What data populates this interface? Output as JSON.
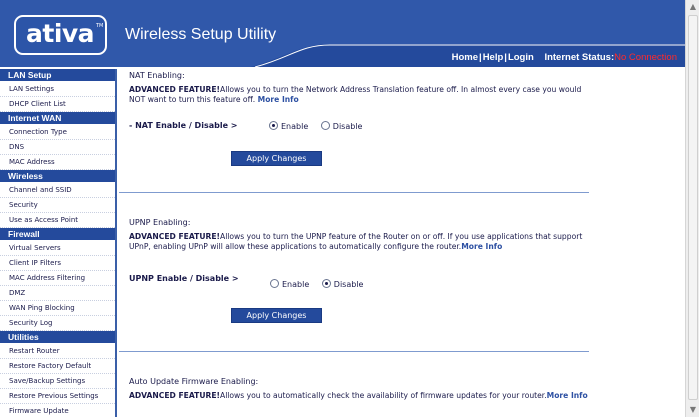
{
  "header": {
    "logo_text": "ativa",
    "logo_tm": "TM",
    "title": "Wireless Setup Utility",
    "nav_home": "Home",
    "nav_help": "Help",
    "nav_login": "Login",
    "nav_sep": "|",
    "status_label": "Internet Status:",
    "status_value": "No Connection",
    "status_color": "#ff2a2a"
  },
  "colors": {
    "brand_blue": "#244a9c",
    "link_blue": "#2e51a3"
  },
  "sidebar": {
    "sections": [
      {
        "title": "LAN Setup",
        "items": [
          "LAN Settings",
          "DHCP Client List"
        ]
      },
      {
        "title": "Internet WAN",
        "items": [
          "Connection Type",
          "DNS",
          "MAC Address"
        ]
      },
      {
        "title": "Wireless",
        "items": [
          "Channel and SSID",
          "Security",
          "Use as Access Point"
        ]
      },
      {
        "title": "Firewall",
        "items": [
          "Virtual Servers",
          "Client IP Filters",
          "MAC Address Filtering",
          "DMZ",
          "WAN Ping Blocking",
          "Security Log"
        ]
      },
      {
        "title": "Utilities",
        "items": [
          "Restart Router",
          "Restore Factory Default",
          "Save/Backup Settings",
          "Restore Previous Settings",
          "Firmware Update"
        ]
      }
    ]
  },
  "nat": {
    "title": "NAT Enabling:",
    "adv_label": "ADVANCED FEATURE!",
    "desc": "Allows you to turn the Network Address Translation feature off. In almost every case you would NOT want to turn this feature off.",
    "more": "More Info",
    "option_label": "- NAT Enable / Disable >",
    "enable": "Enable",
    "disable": "Disable",
    "selected": "enable",
    "apply": "Apply Changes"
  },
  "upnp": {
    "title": "UPNP Enabling:",
    "adv_label": "ADVANCED FEATURE!",
    "desc": "Allows you to turn the UPNP feature of the Router on or off. If you use applications that support UPnP, enabling UPnP will allow these applications to automatically configure the router.",
    "more": "More Info",
    "option_label": "UPNP Enable / Disable >",
    "enable": "Enable",
    "disable": "Disable",
    "selected": "disable",
    "apply": "Apply Changes"
  },
  "firmware": {
    "title": "Auto Update Firmware Enabling:",
    "adv_label": "ADVANCED FEATURE!",
    "desc": "Allows you to automatically check the availability of firmware updates for your router.",
    "more": "More Info"
  }
}
